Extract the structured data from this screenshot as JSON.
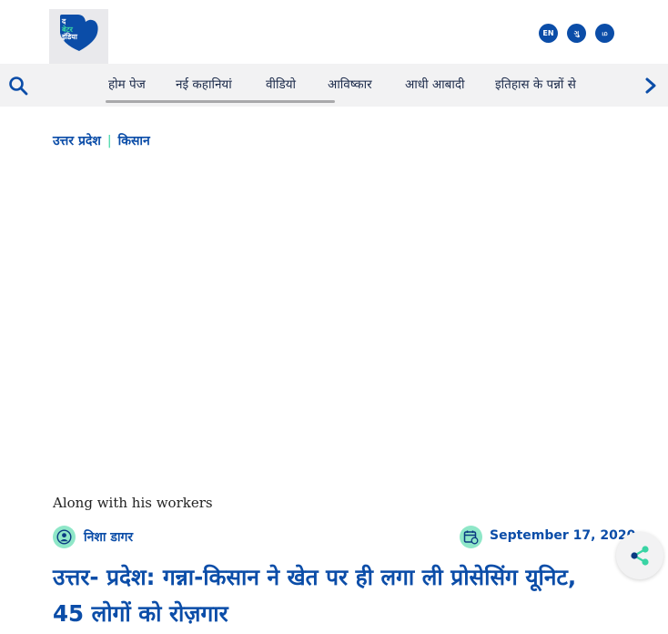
{
  "header": {
    "logo_lines": [
      "द",
      "बेटर",
      "इंडिया"
    ],
    "languages": [
      "EN",
      "ગુ",
      "ம"
    ]
  },
  "nav": {
    "items": [
      "होम पेज",
      "नई कहानियां",
      "वीडियो",
      "आविष्कार",
      "आधी आबादी",
      "इतिहास के पन्नों से"
    ]
  },
  "breadcrumb": {
    "items": [
      "उत्तर प्रदेश",
      "किसान"
    ],
    "separator": "|"
  },
  "article": {
    "image_caption": "Along with his workers",
    "author": "निशा डागर",
    "date": "September 17, 2020",
    "title": "उत्तर- प्रदेश: गन्ना-किसान ने खेत पर ही लगा ली प्रोसेसिंग यूनिट, 45 लोगों को रोज़गार"
  },
  "colors": {
    "brand_blue": "#0b4da8",
    "accent_green": "#39d4a4",
    "nav_bg": "#f2f2f3"
  },
  "icons": [
    "search-icon",
    "chevron-right-icon",
    "user-icon",
    "calendar-icon",
    "share-icon"
  ]
}
